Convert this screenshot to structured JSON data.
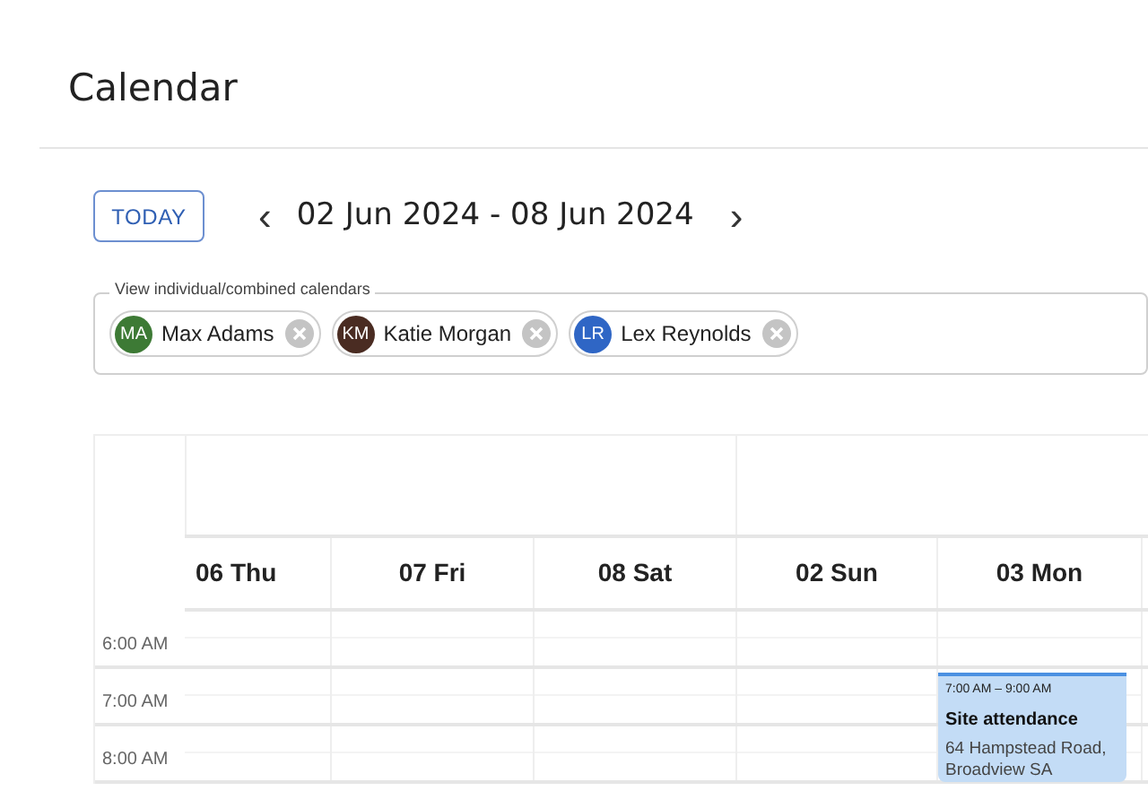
{
  "page_title": "Calendar",
  "toolbar": {
    "today_button": "TODAY",
    "prev": "‹",
    "range": "02 Jun 2024 - 08 Jun 2024",
    "next": "›"
  },
  "calendar_filter": {
    "legend": "View individual/combined calendars",
    "chips": [
      {
        "initials": "MA",
        "name": "Max Adams",
        "color": "#3d7a35"
      },
      {
        "initials": "KM",
        "name": "Katie Morgan",
        "color": "#4a2c22"
      },
      {
        "initials": "LR",
        "name": "Lex Reynolds",
        "color": "#2f66c5"
      }
    ]
  },
  "week": {
    "days": [
      {
        "label": "06 Thu"
      },
      {
        "label": "07 Fri"
      },
      {
        "label": "08 Sat"
      },
      {
        "label": "02 Sun"
      },
      {
        "label": "03 Mon",
        "events": [
          {
            "time": "7:00 AM – 9:00 AM",
            "title": "Site attendance",
            "location": "64 Hampstead Road, Broadview SA"
          }
        ]
      }
    ],
    "times": [
      "6:00 AM",
      "7:00 AM",
      "8:00 AM"
    ]
  }
}
